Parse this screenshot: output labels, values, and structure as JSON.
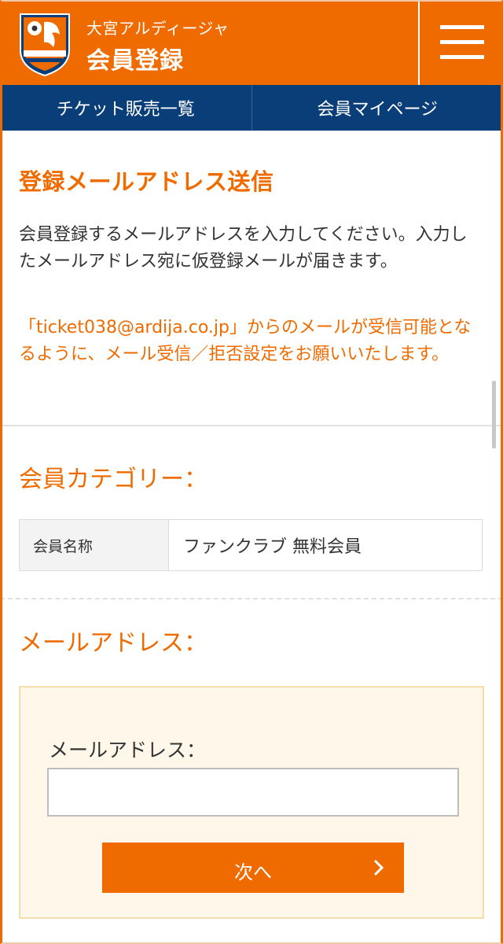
{
  "header": {
    "club_name": "大宮アルディージャ",
    "page_title": "会員登録",
    "logo_icon": "club-crest-icon",
    "menu_icon": "hamburger-menu-icon",
    "brand_color": "#ef6b00",
    "nav_color": "#0a3e78"
  },
  "nav": {
    "items": [
      {
        "label": "チケット販売一覧"
      },
      {
        "label": "会員マイページ"
      }
    ]
  },
  "main": {
    "heading": "登録メールアドレス送信",
    "description": "会員登録するメールアドレスを入力してください。入力したメールアドレス宛に仮登録メールが届きます。",
    "notice": "「ticket038@ardija.co.jp」からのメールが受信可能となるように、メール受信／拒否設定をお願いいたします。"
  },
  "category_section": {
    "title": "会員カテゴリー：",
    "row_label": "会員名称",
    "row_value": "ファンクラブ 無料会員"
  },
  "email_section": {
    "title": "メールアドレス：",
    "field_label": "メールアドレス：",
    "input_value": "",
    "next_button": "次へ",
    "next_icon": "chevron-right-icon"
  }
}
